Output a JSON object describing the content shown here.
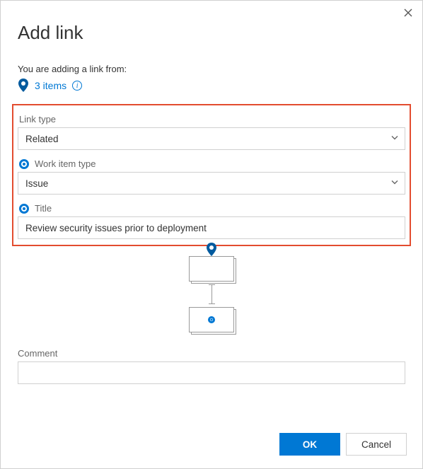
{
  "dialog": {
    "title": "Add link",
    "subtitle": "You are adding a link from:",
    "items_text": "3 items"
  },
  "fields": {
    "link_type_label": "Link type",
    "link_type_value": "Related",
    "work_item_type_label": "Work item type",
    "work_item_type_value": "Issue",
    "title_label": "Title",
    "title_value": "Review security issues prior to deployment",
    "comment_label": "Comment",
    "comment_value": ""
  },
  "buttons": {
    "ok": "OK",
    "cancel": "Cancel"
  },
  "colors": {
    "accent": "#0078d4",
    "highlight_border": "#e34c2f"
  }
}
